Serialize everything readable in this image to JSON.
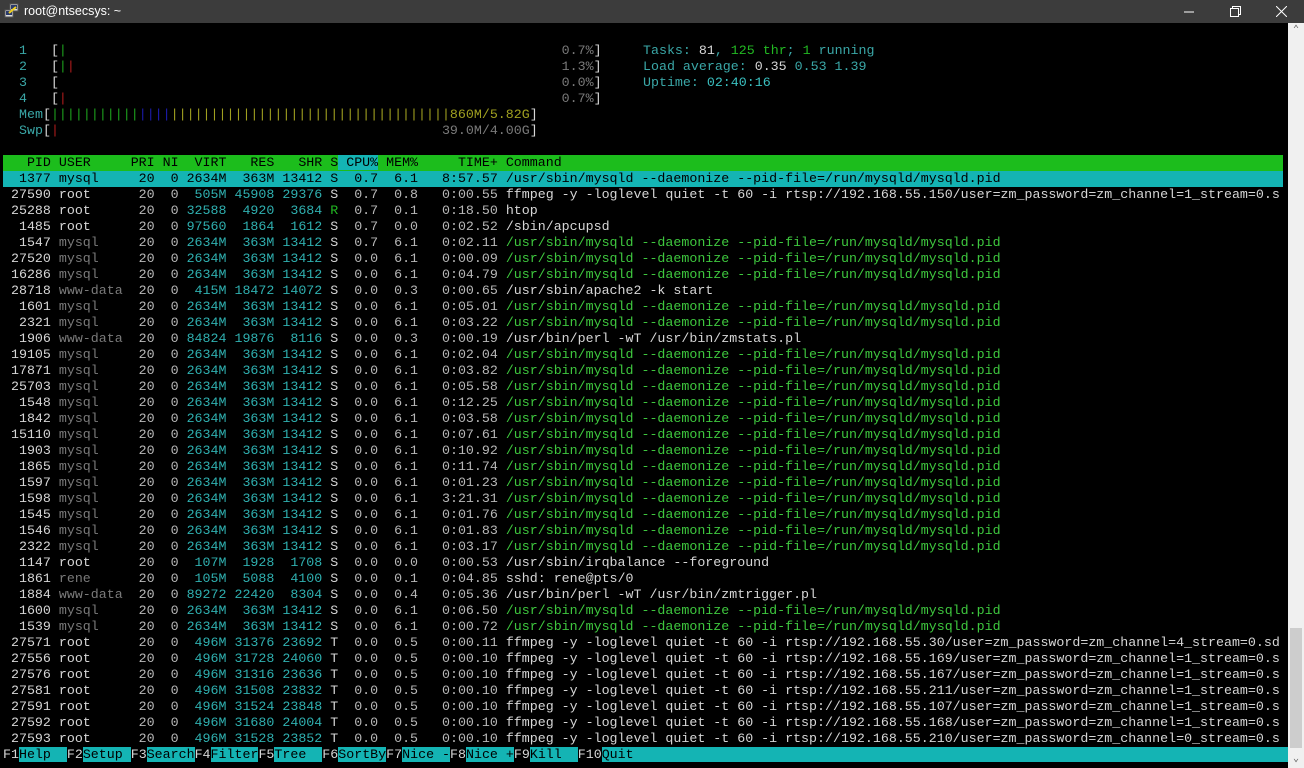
{
  "window": {
    "title": "root@ntsecsys: ~",
    "minimize_icon": "minimize-icon",
    "maximize_icon": "restore-icon",
    "close_icon": "close-icon"
  },
  "meters": {
    "cpus": [
      {
        "label": "1",
        "percent": "0.7%",
        "bars": [
          {
            "color": "green",
            "count": 1
          }
        ]
      },
      {
        "label": "2",
        "percent": "1.3%",
        "bars": [
          {
            "color": "green",
            "count": 1
          },
          {
            "color": "red",
            "count": 1
          }
        ]
      },
      {
        "label": "3",
        "percent": "0.0%",
        "bars": []
      },
      {
        "label": "4",
        "percent": "0.7%",
        "bars": [
          {
            "color": "red",
            "count": 1
          }
        ]
      }
    ],
    "mem": {
      "label": "Mem",
      "value": "860M/5.82G",
      "bars": [
        {
          "color": "green",
          "count": 11
        },
        {
          "color": "blue",
          "count": 4
        },
        {
          "color": "yellow",
          "count": 35
        }
      ]
    },
    "swp": {
      "label": "Swp",
      "value": "39.0M/4.00G",
      "bars": [
        {
          "color": "red",
          "count": 1
        }
      ]
    }
  },
  "summary": {
    "tasks_label": "Tasks: ",
    "tasks": "81",
    "thr": "125",
    "thr_label": " thr",
    "running": "1",
    "running_label": " running",
    "load_label": "Load average: ",
    "load1": "0.35",
    "load5": "0.53",
    "load15": "1.39",
    "uptime_label": "Uptime: ",
    "uptime": "02:40:16"
  },
  "table": {
    "columns": [
      "PID",
      "USER",
      "PRI",
      "NI",
      "VIRT",
      "RES",
      "SHR",
      "S",
      "CPU%",
      "MEM%",
      "TIME+",
      "Command"
    ],
    "sort_column": "CPU%",
    "selected_index": 0,
    "rows": [
      [
        "1377",
        "mysql",
        "20",
        "0",
        "2634M",
        "363M",
        "13412",
        "S",
        "0.7",
        "6.1",
        "8:57.57",
        "/usr/sbin/mysqld --daemonize --pid-file=/run/mysqld/mysqld.pid"
      ],
      [
        "27590",
        "root",
        "20",
        "0",
        "505M",
        "45908",
        "29376",
        "S",
        "0.7",
        "0.8",
        "0:00.55",
        "ffmpeg -y -loglevel quiet -t 60 -i rtsp://192.168.55.150/user=zm_password=zm_channel=1_stream=0.s"
      ],
      [
        "25288",
        "root",
        "20",
        "0",
        "32588",
        "4920",
        "3684",
        "R",
        "0.7",
        "0.1",
        "0:18.50",
        "htop"
      ],
      [
        "1485",
        "root",
        "20",
        "0",
        "97560",
        "1864",
        "1612",
        "S",
        "0.7",
        "0.0",
        "0:02.52",
        "/sbin/apcupsd"
      ],
      [
        "1547",
        "mysql",
        "20",
        "0",
        "2634M",
        "363M",
        "13412",
        "S",
        "0.7",
        "6.1",
        "0:02.11",
        "/usr/sbin/mysqld --daemonize --pid-file=/run/mysqld/mysqld.pid"
      ],
      [
        "27520",
        "mysql",
        "20",
        "0",
        "2634M",
        "363M",
        "13412",
        "S",
        "0.0",
        "6.1",
        "0:00.09",
        "/usr/sbin/mysqld --daemonize --pid-file=/run/mysqld/mysqld.pid"
      ],
      [
        "16286",
        "mysql",
        "20",
        "0",
        "2634M",
        "363M",
        "13412",
        "S",
        "0.0",
        "6.1",
        "0:04.79",
        "/usr/sbin/mysqld --daemonize --pid-file=/run/mysqld/mysqld.pid"
      ],
      [
        "28718",
        "www-data",
        "20",
        "0",
        "415M",
        "18472",
        "14072",
        "S",
        "0.0",
        "0.3",
        "0:00.65",
        "/usr/sbin/apache2 -k start"
      ],
      [
        "1601",
        "mysql",
        "20",
        "0",
        "2634M",
        "363M",
        "13412",
        "S",
        "0.0",
        "6.1",
        "0:05.01",
        "/usr/sbin/mysqld --daemonize --pid-file=/run/mysqld/mysqld.pid"
      ],
      [
        "2321",
        "mysql",
        "20",
        "0",
        "2634M",
        "363M",
        "13412",
        "S",
        "0.0",
        "6.1",
        "0:03.22",
        "/usr/sbin/mysqld --daemonize --pid-file=/run/mysqld/mysqld.pid"
      ],
      [
        "1906",
        "www-data",
        "20",
        "0",
        "84824",
        "19876",
        "8116",
        "S",
        "0.0",
        "0.3",
        "0:00.19",
        "/usr/bin/perl -wT /usr/bin/zmstats.pl"
      ],
      [
        "19105",
        "mysql",
        "20",
        "0",
        "2634M",
        "363M",
        "13412",
        "S",
        "0.0",
        "6.1",
        "0:02.04",
        "/usr/sbin/mysqld --daemonize --pid-file=/run/mysqld/mysqld.pid"
      ],
      [
        "17871",
        "mysql",
        "20",
        "0",
        "2634M",
        "363M",
        "13412",
        "S",
        "0.0",
        "6.1",
        "0:03.82",
        "/usr/sbin/mysqld --daemonize --pid-file=/run/mysqld/mysqld.pid"
      ],
      [
        "25703",
        "mysql",
        "20",
        "0",
        "2634M",
        "363M",
        "13412",
        "S",
        "0.0",
        "6.1",
        "0:05.58",
        "/usr/sbin/mysqld --daemonize --pid-file=/run/mysqld/mysqld.pid"
      ],
      [
        "1548",
        "mysql",
        "20",
        "0",
        "2634M",
        "363M",
        "13412",
        "S",
        "0.0",
        "6.1",
        "0:12.25",
        "/usr/sbin/mysqld --daemonize --pid-file=/run/mysqld/mysqld.pid"
      ],
      [
        "1842",
        "mysql",
        "20",
        "0",
        "2634M",
        "363M",
        "13412",
        "S",
        "0.0",
        "6.1",
        "0:03.58",
        "/usr/sbin/mysqld --daemonize --pid-file=/run/mysqld/mysqld.pid"
      ],
      [
        "15110",
        "mysql",
        "20",
        "0",
        "2634M",
        "363M",
        "13412",
        "S",
        "0.0",
        "6.1",
        "0:07.61",
        "/usr/sbin/mysqld --daemonize --pid-file=/run/mysqld/mysqld.pid"
      ],
      [
        "1903",
        "mysql",
        "20",
        "0",
        "2634M",
        "363M",
        "13412",
        "S",
        "0.0",
        "6.1",
        "0:10.92",
        "/usr/sbin/mysqld --daemonize --pid-file=/run/mysqld/mysqld.pid"
      ],
      [
        "1865",
        "mysql",
        "20",
        "0",
        "2634M",
        "363M",
        "13412",
        "S",
        "0.0",
        "6.1",
        "0:11.74",
        "/usr/sbin/mysqld --daemonize --pid-file=/run/mysqld/mysqld.pid"
      ],
      [
        "1597",
        "mysql",
        "20",
        "0",
        "2634M",
        "363M",
        "13412",
        "S",
        "0.0",
        "6.1",
        "0:01.23",
        "/usr/sbin/mysqld --daemonize --pid-file=/run/mysqld/mysqld.pid"
      ],
      [
        "1598",
        "mysql",
        "20",
        "0",
        "2634M",
        "363M",
        "13412",
        "S",
        "0.0",
        "6.1",
        "3:21.31",
        "/usr/sbin/mysqld --daemonize --pid-file=/run/mysqld/mysqld.pid"
      ],
      [
        "1545",
        "mysql",
        "20",
        "0",
        "2634M",
        "363M",
        "13412",
        "S",
        "0.0",
        "6.1",
        "0:01.76",
        "/usr/sbin/mysqld --daemonize --pid-file=/run/mysqld/mysqld.pid"
      ],
      [
        "1546",
        "mysql",
        "20",
        "0",
        "2634M",
        "363M",
        "13412",
        "S",
        "0.0",
        "6.1",
        "0:01.83",
        "/usr/sbin/mysqld --daemonize --pid-file=/run/mysqld/mysqld.pid"
      ],
      [
        "2322",
        "mysql",
        "20",
        "0",
        "2634M",
        "363M",
        "13412",
        "S",
        "0.0",
        "6.1",
        "0:03.17",
        "/usr/sbin/mysqld --daemonize --pid-file=/run/mysqld/mysqld.pid"
      ],
      [
        "1147",
        "root",
        "20",
        "0",
        "107M",
        "1928",
        "1708",
        "S",
        "0.0",
        "0.0",
        "0:00.53",
        "/usr/sbin/irqbalance --foreground"
      ],
      [
        "1861",
        "rene",
        "20",
        "0",
        "105M",
        "5088",
        "4100",
        "S",
        "0.0",
        "0.1",
        "0:04.85",
        "sshd: rene@pts/0"
      ],
      [
        "1884",
        "www-data",
        "20",
        "0",
        "89272",
        "22420",
        "8304",
        "S",
        "0.0",
        "0.4",
        "0:05.36",
        "/usr/bin/perl -wT /usr/bin/zmtrigger.pl"
      ],
      [
        "1600",
        "mysql",
        "20",
        "0",
        "2634M",
        "363M",
        "13412",
        "S",
        "0.0",
        "6.1",
        "0:06.50",
        "/usr/sbin/mysqld --daemonize --pid-file=/run/mysqld/mysqld.pid"
      ],
      [
        "1539",
        "mysql",
        "20",
        "0",
        "2634M",
        "363M",
        "13412",
        "S",
        "0.0",
        "6.1",
        "0:00.72",
        "/usr/sbin/mysqld --daemonize --pid-file=/run/mysqld/mysqld.pid"
      ],
      [
        "27571",
        "root",
        "20",
        "0",
        "496M",
        "31376",
        "23692",
        "T",
        "0.0",
        "0.5",
        "0:00.11",
        "ffmpeg -y -loglevel quiet -t 60 -i rtsp://192.168.55.30/user=zm_password=zm_channel=4_stream=0.sd"
      ],
      [
        "27556",
        "root",
        "20",
        "0",
        "496M",
        "31728",
        "24060",
        "T",
        "0.0",
        "0.5",
        "0:00.10",
        "ffmpeg -y -loglevel quiet -t 60 -i rtsp://192.168.55.169/user=zm_password=zm_channel=1_stream=0.s"
      ],
      [
        "27576",
        "root",
        "20",
        "0",
        "496M",
        "31316",
        "23636",
        "T",
        "0.0",
        "0.5",
        "0:00.10",
        "ffmpeg -y -loglevel quiet -t 60 -i rtsp://192.168.55.167/user=zm_password=zm_channel=1_stream=0.s"
      ],
      [
        "27581",
        "root",
        "20",
        "0",
        "496M",
        "31508",
        "23832",
        "T",
        "0.0",
        "0.5",
        "0:00.10",
        "ffmpeg -y -loglevel quiet -t 60 -i rtsp://192.168.55.211/user=zm_password=zm_channel=1_stream=0.s"
      ],
      [
        "27591",
        "root",
        "20",
        "0",
        "496M",
        "31524",
        "23848",
        "T",
        "0.0",
        "0.5",
        "0:00.10",
        "ffmpeg -y -loglevel quiet -t 60 -i rtsp://192.168.55.107/user=zm_password=zm_channel=1_stream=0.s"
      ],
      [
        "27592",
        "root",
        "20",
        "0",
        "496M",
        "31680",
        "24004",
        "T",
        "0.0",
        "0.5",
        "0:00.10",
        "ffmpeg -y -loglevel quiet -t 60 -i rtsp://192.168.55.168/user=zm_password=zm_channel=1_stream=0.s"
      ],
      [
        "27593",
        "root",
        "20",
        "0",
        "496M",
        "31528",
        "23852",
        "T",
        "0.0",
        "0.5",
        "0:00.10",
        "ffmpeg -y -loglevel quiet -t 60 -i rtsp://192.168.55.210/user=zm_password=zm_channel=0_stream=0.s"
      ]
    ]
  },
  "footer": [
    {
      "key": "F1",
      "label": "Help  "
    },
    {
      "key": "F2",
      "label": "Setup "
    },
    {
      "key": "F3",
      "label": "Search"
    },
    {
      "key": "F4",
      "label": "Filter"
    },
    {
      "key": "F5",
      "label": "Tree  "
    },
    {
      "key": "F6",
      "label": "SortBy"
    },
    {
      "key": "F7",
      "label": "Nice -"
    },
    {
      "key": "F8",
      "label": "Nice +"
    },
    {
      "key": "F9",
      "label": "Kill  "
    },
    {
      "key": "F10",
      "label": "Quit"
    }
  ],
  "colors": {
    "header_bg": "#1cbd1c",
    "selection_bg": "#14b4b4",
    "titlebar_bg": "#3c3c3c"
  }
}
